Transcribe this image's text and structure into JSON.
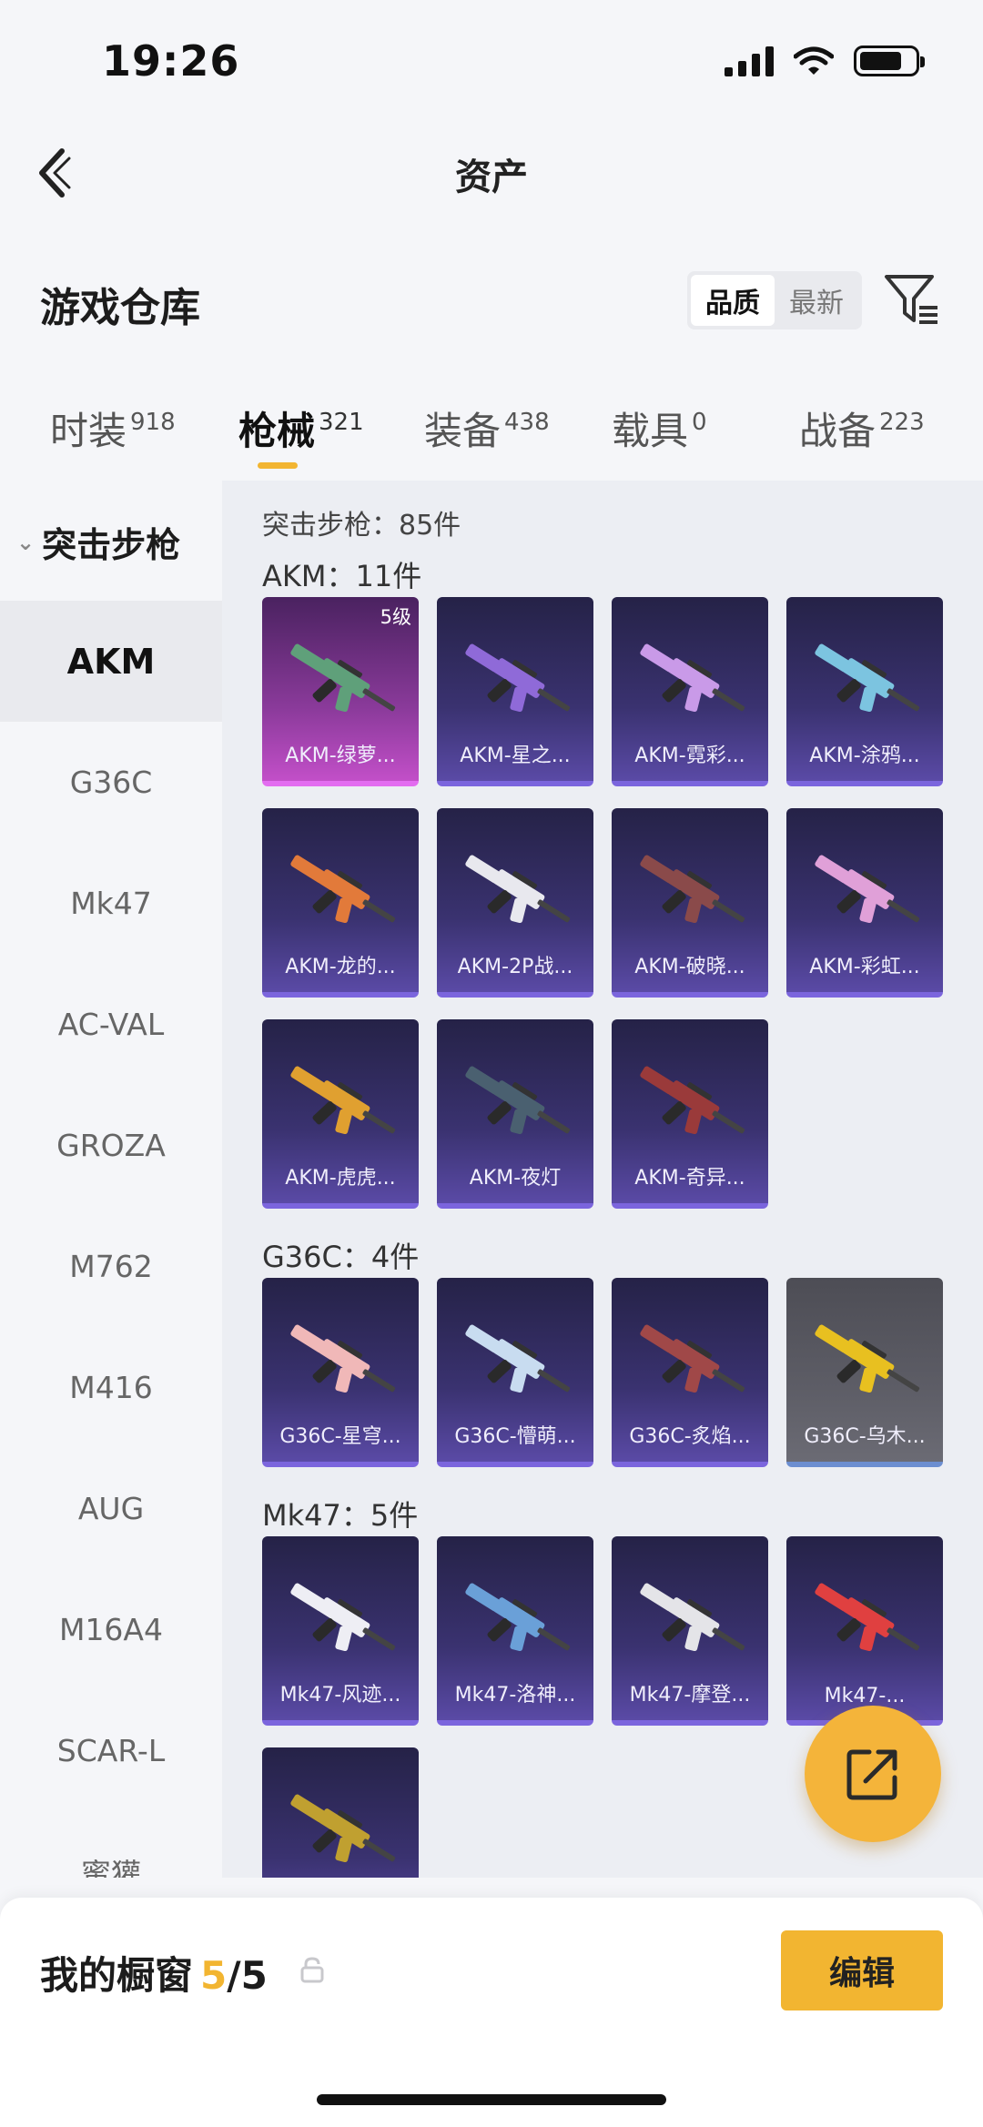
{
  "status": {
    "time": "19:26"
  },
  "nav": {
    "title": "资产"
  },
  "header": {
    "title": "游戏仓库",
    "sort_options": [
      "品质",
      "最新"
    ],
    "sort_active": "品质"
  },
  "tabs": [
    {
      "label": "时装",
      "count": "918"
    },
    {
      "label": "枪械",
      "count": "321",
      "active": true
    },
    {
      "label": "装备",
      "count": "438"
    },
    {
      "label": "载具",
      "count": "0"
    },
    {
      "label": "战备",
      "count": "223"
    }
  ],
  "sidebar": {
    "group": "突击步枪",
    "items": [
      "AKM",
      "G36C",
      "Mk47",
      "AC-VAL",
      "GROZA",
      "M762",
      "M416",
      "AUG",
      "M16A4",
      "SCAR-L",
      "蜜獾"
    ],
    "active": "AKM"
  },
  "content": {
    "header": "突击步枪：85件",
    "groups": [
      {
        "title": "AKM：11件",
        "items": [
          {
            "name": "AKM-绿萝...",
            "level": "5级",
            "rarity": "pink",
            "color": "#5fa07a"
          },
          {
            "name": "AKM-星之...",
            "rarity": "purple",
            "color": "#8f6ad8"
          },
          {
            "name": "AKM-霓彩...",
            "rarity": "purple",
            "color": "#c99ae8"
          },
          {
            "name": "AKM-涂鸦...",
            "rarity": "purple",
            "color": "#7cc4e0"
          },
          {
            "name": "AKM-龙的...",
            "rarity": "purple",
            "color": "#e27a3a"
          },
          {
            "name": "AKM-2P战...",
            "rarity": "purple",
            "color": "#e8e8ee"
          },
          {
            "name": "AKM-破晓...",
            "rarity": "purple",
            "color": "#8a4a4a"
          },
          {
            "name": "AKM-彩虹...",
            "rarity": "purple",
            "color": "#e0a0d8"
          },
          {
            "name": "AKM-虎虎...",
            "rarity": "purple",
            "color": "#e0a030"
          },
          {
            "name": "AKM-夜灯",
            "rarity": "purple",
            "color": "#4a6070"
          },
          {
            "name": "AKM-奇异...",
            "rarity": "purple",
            "color": "#9a3a3a"
          }
        ]
      },
      {
        "title": "G36C：4件",
        "items": [
          {
            "name": "G36C-星穹...",
            "rarity": "purple",
            "color": "#f0b8b8"
          },
          {
            "name": "G36C-懵萌...",
            "rarity": "purple",
            "color": "#c8dcf0"
          },
          {
            "name": "G36C-炙焰...",
            "rarity": "purple",
            "color": "#a04848"
          },
          {
            "name": "G36C-乌木...",
            "rarity": "grey",
            "color": "#e8c020"
          }
        ]
      },
      {
        "title": "Mk47：5件",
        "items": [
          {
            "name": "Mk47-风迹...",
            "rarity": "purple",
            "color": "#eeeef4"
          },
          {
            "name": "Mk47-洛神...",
            "rarity": "purple",
            "color": "#6aa0d8"
          },
          {
            "name": "Mk47-摩登...",
            "rarity": "purple",
            "color": "#e4e4e8"
          },
          {
            "name": "Mk47-...",
            "rarity": "purple",
            "color": "#e04040"
          },
          {
            "name": "",
            "rarity": "purple",
            "color": "#c0a030"
          }
        ]
      }
    ]
  },
  "bottom": {
    "label": "我的橱窗",
    "count_current": "5",
    "count_total": "/5",
    "edit_label": "编辑"
  }
}
